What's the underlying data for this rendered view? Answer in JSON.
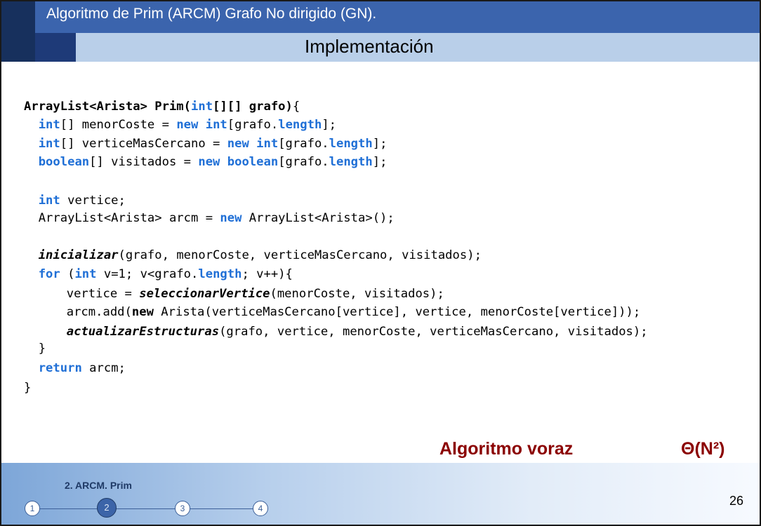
{
  "header": {
    "title": "Algoritmo de Prim (ARCM) Grafo No dirigido (GN).",
    "subtitle": "Implementación"
  },
  "code": {
    "l1": {
      "a": "ArrayList<Arista> Prim(",
      "b": "int",
      "c": "[][] grafo)",
      "d": "{"
    },
    "l2": {
      "a": "  ",
      "b": "int",
      "c": "[] menorCoste = ",
      "d": "new",
      "e": " ",
      "f": "int",
      "g": "[grafo.",
      "h": "length",
      "i": "];"
    },
    "l3": {
      "a": "  ",
      "b": "int",
      "c": "[] verticeMasCercano = ",
      "d": "new",
      "e": " ",
      "f": "int",
      "g": "[grafo.",
      "h": "length",
      "i": "];"
    },
    "l4": {
      "a": "  ",
      "b": "boolean",
      "c": "[] visitados = ",
      "d": "new",
      "e": " ",
      "f": "boolean",
      "g": "[grafo.",
      "h": "length",
      "i": "];"
    },
    "l5": {
      "a": "  ",
      "b": "int",
      "c": " vertice;"
    },
    "l6": {
      "a": "  ArrayList<Arista> arcm = ",
      "b": "new",
      "c": " ArrayList<Arista>();"
    },
    "l7": {
      "a": "  ",
      "b": "inicializar",
      "c": "(grafo, menorCoste, verticeMasCercano, visitados);"
    },
    "l8": {
      "a": "  ",
      "b": "for",
      "c": " (",
      "d": "int",
      "e": " v=1; v<grafo.",
      "f": "length",
      "g": "; v++){"
    },
    "l9": {
      "a": "     vertice = ",
      "b": "seleccionarVertice",
      "c": "(menorCoste, visitados);"
    },
    "l10": {
      "a": "     arcm.add(",
      "b": "new",
      "c": " Arista(verticeMasCercano[vertice], vertice, menorCoste[vertice]));"
    },
    "l11": {
      "a": "     ",
      "b": "actualizarEstructuras",
      "c": "(grafo, vertice, menorCoste, verticeMasCercano, visitados);"
    },
    "l12": {
      "a": "  }"
    },
    "l13": {
      "a": "  ",
      "b": "return",
      "c": " arcm;"
    },
    "l14": {
      "a": "}"
    }
  },
  "labels": {
    "voraz": "Algoritmo voraz",
    "complexity": "Θ(N²)"
  },
  "footer": {
    "section": "2. ARCM. Prim",
    "steps": [
      "1",
      "2",
      "3",
      "4"
    ],
    "active_step": "2",
    "page": "26"
  },
  "colors": {
    "keyword": "#1f6fd6",
    "accent_red": "#8b0000",
    "header_blue": "#3b64ad",
    "header_light": "#b9cfe9"
  }
}
